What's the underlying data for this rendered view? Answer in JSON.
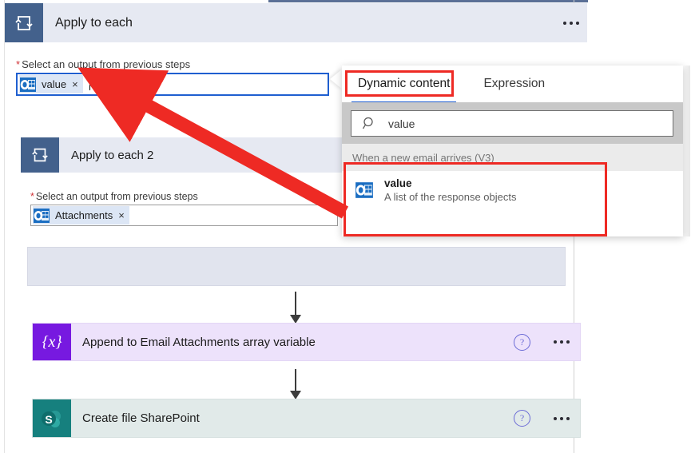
{
  "flow": {
    "apply_each_1": {
      "title": "Apply to each",
      "icon": "loop-icon",
      "menu": "ellipsis-menu",
      "field_label": "Select an output from previous steps",
      "required_marker": "*",
      "token": {
        "label": "value",
        "icon": "outlook-icon",
        "remove": "×"
      }
    },
    "apply_each_2": {
      "title": "Apply to each 2",
      "icon": "loop-icon",
      "field_label": "Select an output from previous steps",
      "required_marker": "*",
      "token": {
        "label": "Attachments",
        "icon": "outlook-icon",
        "remove": "×"
      }
    },
    "actions": [
      {
        "title": "Append to Email Attachments array variable",
        "icon": "variable-icon",
        "icon_glyph": "{x}",
        "icon_color": "#7719e0",
        "card_color": "#ede2fb",
        "help": "?"
      },
      {
        "title": "Create file SharePoint",
        "icon": "sharepoint-icon",
        "icon_glyph": "S",
        "icon_color": "#16807e",
        "card_color": "#e1eae9",
        "help": "?"
      }
    ]
  },
  "flyout": {
    "tabs": [
      {
        "id": "dynamic",
        "label": "Dynamic content",
        "selected": true
      },
      {
        "id": "expression",
        "label": "Expression",
        "selected": false
      }
    ],
    "search": {
      "value": "value",
      "icon": "search-icon"
    },
    "group": {
      "label": "When a new email arrives (V3)"
    },
    "items": [
      {
        "title": "value",
        "subtitle": "A list of the response objects",
        "icon": "outlook-icon"
      }
    ]
  },
  "annotations": {
    "accent_color": "#ee2a24",
    "boxes": [
      "dynamic-content-tab",
      "dynamic-content-list"
    ],
    "arrow": "points from dynamic content value item to the selected output field"
  }
}
